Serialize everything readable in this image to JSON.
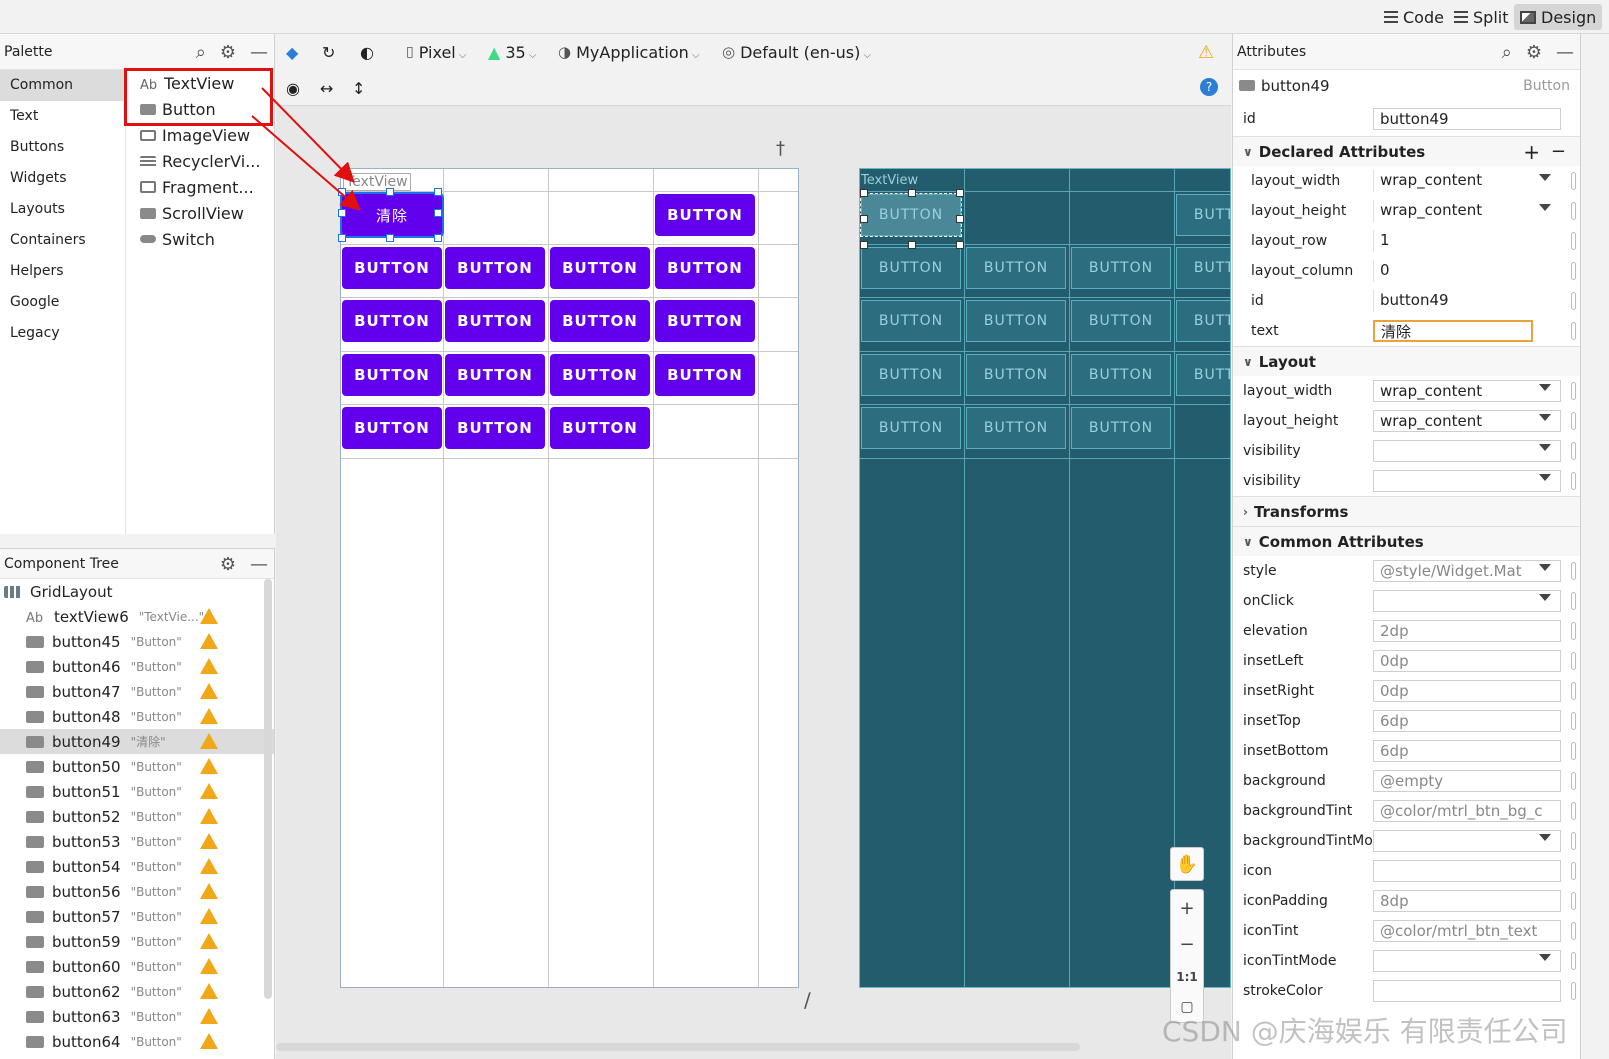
{
  "topbar": {
    "code": "Code",
    "split": "Split",
    "design": "Design"
  },
  "palette": {
    "title": "Palette",
    "categories": [
      "Common",
      "Text",
      "Buttons",
      "Widgets",
      "Layouts",
      "Containers",
      "Helpers",
      "Google",
      "Legacy"
    ],
    "widgets": [
      {
        "label": "TextView",
        "icon": "Ab"
      },
      {
        "label": "Button"
      },
      {
        "label": "ImageView"
      },
      {
        "label": "RecyclerVi..."
      },
      {
        "label": "Fragment..."
      },
      {
        "label": "ScrollView"
      },
      {
        "label": "Switch"
      }
    ]
  },
  "tree": {
    "title": "Component Tree",
    "root": "GridLayout",
    "text_icon": "Ab",
    "rows": [
      {
        "name": "textView6",
        "hint": "\"TextVie...\""
      },
      {
        "name": "button45",
        "hint": "\"Button\""
      },
      {
        "name": "button46",
        "hint": "\"Button\""
      },
      {
        "name": "button47",
        "hint": "\"Button\""
      },
      {
        "name": "button48",
        "hint": "\"Button\""
      },
      {
        "name": "button49",
        "hint": "\"清除\""
      },
      {
        "name": "button50",
        "hint": "\"Button\""
      },
      {
        "name": "button51",
        "hint": "\"Button\""
      },
      {
        "name": "button52",
        "hint": "\"Button\""
      },
      {
        "name": "button53",
        "hint": "\"Button\""
      },
      {
        "name": "button54",
        "hint": "\"Button\""
      },
      {
        "name": "button56",
        "hint": "\"Button\""
      },
      {
        "name": "button57",
        "hint": "\"Button\""
      },
      {
        "name": "button59",
        "hint": "\"Button\""
      },
      {
        "name": "button60",
        "hint": "\"Button\""
      },
      {
        "name": "button62",
        "hint": "\"Button\""
      },
      {
        "name": "button63",
        "hint": "\"Button\""
      },
      {
        "name": "button64",
        "hint": "\"Button\""
      }
    ]
  },
  "canvasbar": {
    "device": "Pixel",
    "api": "35",
    "theme": "MyApplication",
    "locale": "Default (en-us)"
  },
  "design": {
    "textview_label": "TextView",
    "clear_label": "清除",
    "button_label": "BUTTON"
  },
  "attributes": {
    "title": "Attributes",
    "component": "button49",
    "component_type": "Button",
    "id_label": "id",
    "id_value": "button49",
    "declared_title": "Declared Attributes",
    "declared": [
      {
        "label": "layout_width",
        "value": "wrap_content"
      },
      {
        "label": "layout_height",
        "value": "wrap_content"
      },
      {
        "label": "layout_row",
        "value": "1"
      },
      {
        "label": "layout_column",
        "value": "0"
      },
      {
        "label": "id",
        "value": "button49"
      },
      {
        "label": "text",
        "value": "清除"
      }
    ],
    "layout_title": "Layout",
    "layout": [
      {
        "label": "layout_width",
        "value": "wrap_content"
      },
      {
        "label": "layout_height",
        "value": "wrap_content"
      },
      {
        "label": "visibility",
        "value": ""
      },
      {
        "label": "visibility",
        "value": ""
      }
    ],
    "transforms_title": "Transforms",
    "common_title": "Common Attributes",
    "common": [
      {
        "label": "style",
        "value": "@style/Widget.Mat"
      },
      {
        "label": "onClick",
        "value": ""
      },
      {
        "label": "elevation",
        "value": "2dp"
      },
      {
        "label": "insetLeft",
        "value": "0dp"
      },
      {
        "label": "insetRight",
        "value": "0dp"
      },
      {
        "label": "insetTop",
        "value": "6dp"
      },
      {
        "label": "insetBottom",
        "value": "6dp"
      },
      {
        "label": "background",
        "value": "@empty"
      },
      {
        "label": "backgroundTint",
        "value": "@color/mtrl_btn_bg_c"
      },
      {
        "label": "backgroundTintMod...",
        "value": ""
      },
      {
        "label": "icon",
        "value": ""
      },
      {
        "label": "iconPadding",
        "value": "8dp"
      },
      {
        "label": "iconTint",
        "value": "@color/mtrl_btn_text"
      },
      {
        "label": "iconTintMode",
        "value": ""
      },
      {
        "label": "strokeColor",
        "value": ""
      }
    ]
  },
  "watermark": "CSDN @庆海娱乐 有限责任公司",
  "colors": {
    "accent": "#6200ee",
    "blueprint": "#235c6c",
    "warning": "#f0a818",
    "highlight": "#e01010"
  }
}
